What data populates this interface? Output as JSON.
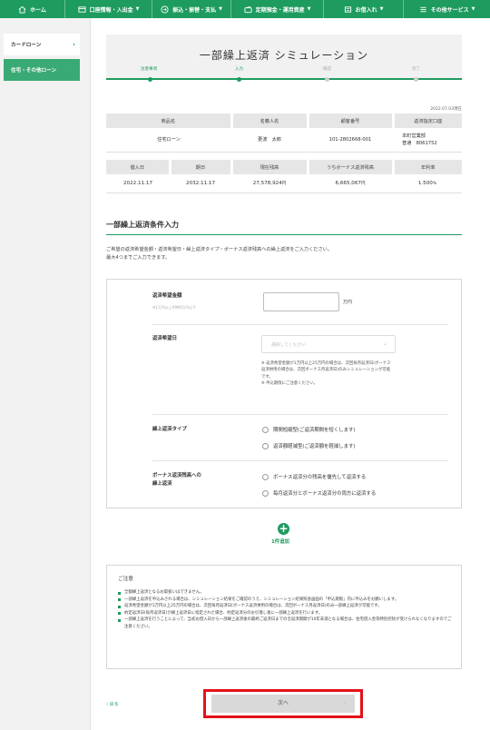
{
  "nav": [
    {
      "label": "ホーム",
      "icon": "home-icon"
    },
    {
      "label": "口座情報・入出金",
      "icon": "bank-icon"
    },
    {
      "label": "振込・振替・支払",
      "icon": "transfer-icon"
    },
    {
      "label": "定期預金・運用資産",
      "icon": "wallet-icon"
    },
    {
      "label": "お借入れ",
      "icon": "loan-icon"
    },
    {
      "label": "その他サービス",
      "icon": "menu-icon"
    }
  ],
  "sidebar": {
    "items": [
      {
        "label": "カードローン"
      },
      {
        "label": "住宅・その他ローン"
      }
    ]
  },
  "page": {
    "title": "一部繰上返済 シミュレーション",
    "steps": [
      "注意事項",
      "入力",
      "確認",
      "完了"
    ],
    "as_of": "2022.07.03現在"
  },
  "loan_table": {
    "headers1": [
      "商品名",
      "名義人名",
      "顧客番号",
      "返済指定口座"
    ],
    "row1": {
      "product": "住宅ローン",
      "holder": "更波　太郎",
      "customer_no": "101-2802668-001",
      "account_branch": "本町営業部",
      "account_no": "普通　8061752"
    },
    "headers2": [
      "借入日",
      "期日",
      "現在残高",
      "うちボーナス返済残高",
      "年利率"
    ],
    "row2": {
      "borrow_date": "2022.11.17",
      "due_date": "2032.11.17",
      "balance": "27,578,924",
      "bonus_balance": "6,665,067",
      "rate": "1.500",
      "yen": "円",
      "pct": "%"
    }
  },
  "section": {
    "title": "一部繰上返済条件入力",
    "desc1": "ご希望の返済希望金額・返済希望日・繰上返済タイプ・ボーナス返済残高への繰上返済をご入力ください。",
    "desc2": "最大4つまでご入力できます。"
  },
  "form": {
    "amount_label": "返済希望金額",
    "amount_sub": "※1万円以上9999万円以下",
    "amount_unit": "万円",
    "date_label": "返済希望日",
    "date_placeholder": "選択してください",
    "date_note1": "※ 返済希望金額が1万円以上25万円の場合は、次回毎月返済日(ボーナス",
    "date_note2": "返済併用の場合は、次回ボーナス月返済日)のみシミュレーションが可能",
    "date_note3": "です。",
    "date_note4": "※ 申込期限にご注意ください。",
    "type_label": "繰上返済タイプ",
    "type_opt1": "期間短縮型(ご返済期間を短くします)",
    "type_opt2": "返済額軽減型(ご返済額を軽減します)",
    "bonus_label1": "ボーナス返済残高への",
    "bonus_label2": "繰上返済",
    "bonus_opt1": "ボーナス返済分の残高を優先して返済する",
    "bonus_opt2": "毎月返済分とボーナス返済分の両方に返済する"
  },
  "add": {
    "label": "1件追加"
  },
  "caution": {
    "title": "ご注意",
    "items": [
      "全額繰上返済となるお取扱いはできません。",
      "一部繰上返済を申込みされる場合は、シミュレーション結果をご確認のうえ、シミュレーション結果照会画面の「申込期限」内に申込みをお願いします。",
      "返済希望金額が1万円以上25万円の場合は、次回毎月返済日(ボーナス返済併用の場合は、次回ボーナス月返済日)のみ一部繰上返済が可能です。",
      "約定返済日(毎月返済日)が繰上返済日に指定された場合、約定返済分のお引落し後に一部繰上返済を行います。",
      "一部繰上返済を行うことによって、当初お借入日から一部繰上返済後の最終ご返済日までの全返済期間が10年未満となる場合は、住宅借入金等特別控除が受けられなくなりますのでご注意ください。"
    ]
  },
  "footer": {
    "back_label": "戻る",
    "next_label": "次へ"
  },
  "colors": {
    "brand": "#1e9b5f",
    "highlight": "#e4121a"
  }
}
